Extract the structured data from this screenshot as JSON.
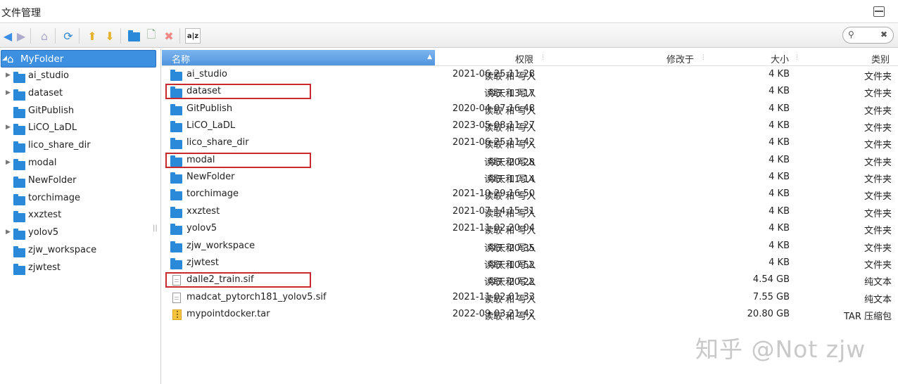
{
  "window": {
    "title": "文件管理"
  },
  "toolbar": {
    "buttons": [
      "back-icon",
      "forward-icon",
      "home-icon",
      "refresh-icon",
      "upload-icon",
      "download-icon",
      "new-folder-icon",
      "new-file-icon",
      "delete-icon",
      "rename-icon"
    ],
    "rename_label": "a|z"
  },
  "search": {
    "placeholder": ""
  },
  "sidebar": {
    "root": "MyFolder",
    "items": [
      {
        "label": "ai_studio",
        "expandable": true
      },
      {
        "label": "dataset",
        "expandable": true
      },
      {
        "label": "GitPublish",
        "expandable": false
      },
      {
        "label": "LiCO_LaDL",
        "expandable": true
      },
      {
        "label": "lico_share_dir",
        "expandable": false
      },
      {
        "label": "modal",
        "expandable": true
      },
      {
        "label": "NewFolder",
        "expandable": false
      },
      {
        "label": "torchimage",
        "expandable": false
      },
      {
        "label": "xxztest",
        "expandable": false
      },
      {
        "label": "yolov5",
        "expandable": true
      },
      {
        "label": "zjw_workspace",
        "expandable": false
      },
      {
        "label": "zjwtest",
        "expandable": false
      }
    ]
  },
  "columns": {
    "name": "名称",
    "permission": "权限",
    "modified": "修改于",
    "size": "大小",
    "type": "类别"
  },
  "files": [
    {
      "name": "ai_studio",
      "perm": "读取 和 写入",
      "date": "2021-06-25 11:28",
      "size": "4 KB",
      "type": "文件夹",
      "icon": "folder"
    },
    {
      "name": "dataset",
      "perm": "读取 和 写入",
      "date": "今天 13:17",
      "size": "4 KB",
      "type": "文件夹",
      "icon": "folder",
      "highlighted": true
    },
    {
      "name": "GitPublish",
      "perm": "读取 和 写入",
      "date": "2020-04-07 16:48",
      "size": "4 KB",
      "type": "文件夹",
      "icon": "folder"
    },
    {
      "name": "LiCO_LaDL",
      "perm": "读取 和 写入",
      "date": "2023-05-08 11:27",
      "size": "4 KB",
      "type": "文件夹",
      "icon": "folder"
    },
    {
      "name": "lico_share_dir",
      "perm": "读取 和 写入",
      "date": "2021-06-25 11:42",
      "size": "4 KB",
      "type": "文件夹",
      "icon": "folder"
    },
    {
      "name": "modal",
      "perm": "读取 和 写入",
      "date": "今天 20:28",
      "size": "4 KB",
      "type": "文件夹",
      "icon": "folder",
      "highlighted": true
    },
    {
      "name": "NewFolder",
      "perm": "读取 和 写入",
      "date": "今天 11:14",
      "size": "4 KB",
      "type": "文件夹",
      "icon": "folder"
    },
    {
      "name": "torchimage",
      "perm": "读取 和 写入",
      "date": "2021-10-29 16:50",
      "size": "4 KB",
      "type": "文件夹",
      "icon": "folder"
    },
    {
      "name": "xxztest",
      "perm": "读取 和 写入",
      "date": "2021-07-14 15:31",
      "size": "4 KB",
      "type": "文件夹",
      "icon": "folder"
    },
    {
      "name": "yolov5",
      "perm": "读取 和 写入",
      "date": "2021-11-02 20:04",
      "size": "4 KB",
      "type": "文件夹",
      "icon": "folder"
    },
    {
      "name": "zjw_workspace",
      "perm": "读取 和 写入",
      "date": "今天 20:35",
      "size": "4 KB",
      "type": "文件夹",
      "icon": "folder"
    },
    {
      "name": "zjwtest",
      "perm": "读取 和 写入",
      "date": "今天 10:52",
      "size": "4 KB",
      "type": "文件夹",
      "icon": "folder"
    },
    {
      "name": "dalle2_train.sif",
      "perm": "读取 和 写入",
      "date": "今天 20:22",
      "size": "4.54 GB",
      "type": "纯文本",
      "icon": "text-file",
      "highlighted": true
    },
    {
      "name": "madcat_pytorch181_yolov5.sif",
      "perm": "读取 和 写入",
      "date": "2021-11-02 01:33",
      "size": "7.55 GB",
      "type": "纯文本",
      "icon": "text-file"
    },
    {
      "name": "mypointdocker.tar",
      "perm": "读取 和 写入",
      "date": "2022-09-03 21:42",
      "size": "20.80 GB",
      "type": "TAR 压缩包",
      "icon": "archive-file"
    }
  ],
  "watermark": "知乎 @Not zjw",
  "colors": {
    "accent": "#3d8fe0",
    "folder": "#2a8ad9",
    "highlight_box": "#c8282e"
  }
}
